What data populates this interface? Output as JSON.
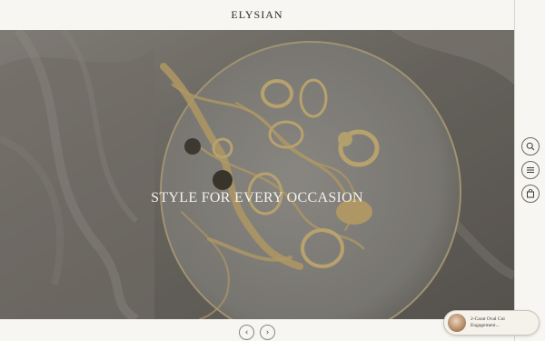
{
  "header": {
    "brand": "ELYSIAN"
  },
  "hero": {
    "title": "STYLE FOR EVERY OCCASION"
  },
  "carousel": {
    "prev_icon": "chevron-left-icon",
    "next_icon": "chevron-right-icon",
    "prev_glyph": "‹",
    "next_glyph": "›"
  },
  "side_rail": {
    "items": [
      {
        "icon": "search-icon"
      },
      {
        "icon": "menu-icon"
      },
      {
        "icon": "shopping-bag-icon"
      }
    ]
  },
  "product_pill": {
    "label": "2-Carat Oval Cut Engagement..."
  },
  "colors": {
    "background": "#f7f6f3",
    "text": "#2b2a27",
    "hero_overlay": "#6c6761",
    "hero_text": "#f4f1ea"
  }
}
